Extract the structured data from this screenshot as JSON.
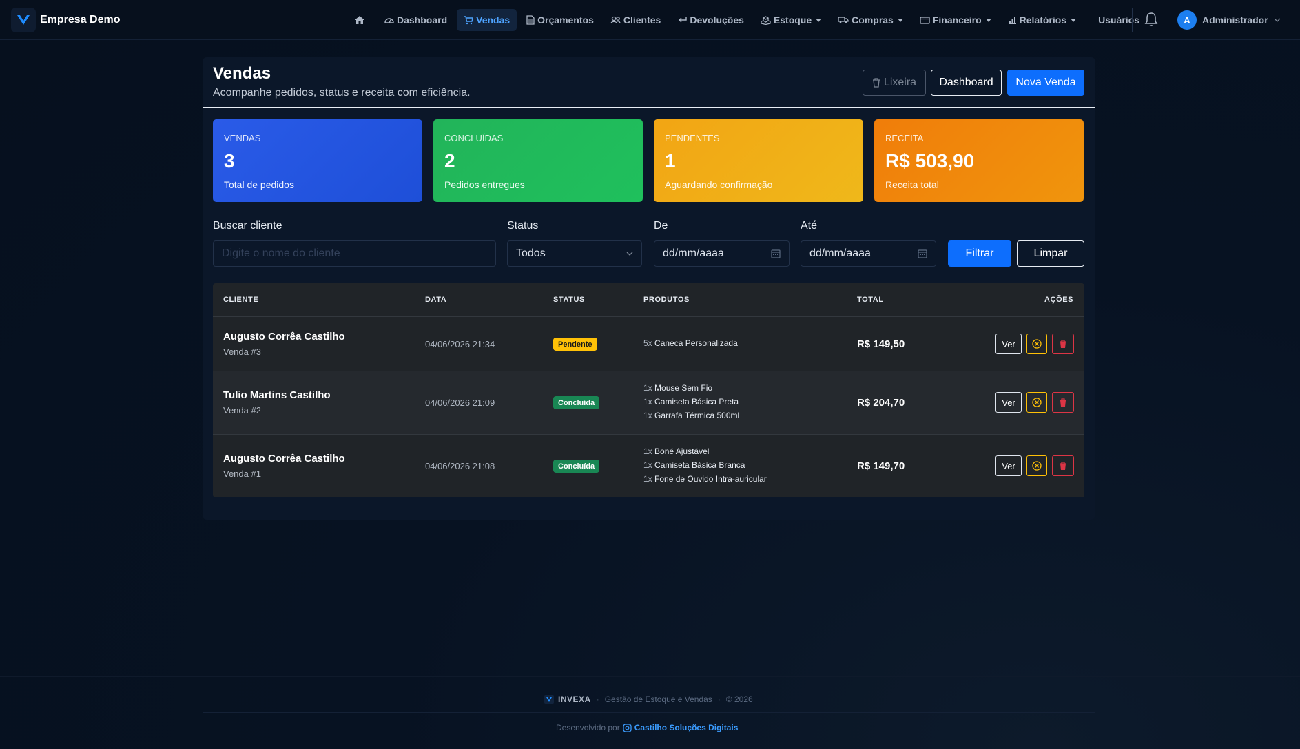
{
  "brand": {
    "name": "Empresa Demo"
  },
  "nav": {
    "items": [
      {
        "label": "",
        "icon": "home-icon"
      },
      {
        "label": "Dashboard",
        "icon": "gauge-icon"
      },
      {
        "label": "Vendas",
        "icon": "cart-icon",
        "active": true
      },
      {
        "label": "Orçamentos",
        "icon": "document-icon"
      },
      {
        "label": "Clientes",
        "icon": "people-icon"
      },
      {
        "label": "Devoluções",
        "icon": "return-icon"
      },
      {
        "label": "Estoque",
        "icon": "boxes-icon",
        "dropdown": true
      },
      {
        "label": "Compras",
        "icon": "truck-icon",
        "dropdown": true
      },
      {
        "label": "Financeiro",
        "icon": "wallet-icon",
        "dropdown": true
      },
      {
        "label": "Relatórios",
        "icon": "bar-chart-icon",
        "dropdown": true
      },
      {
        "label": "Usuários",
        "icon": ""
      }
    ],
    "user": {
      "initial": "A",
      "name": "Administrador"
    }
  },
  "header": {
    "title": "Vendas",
    "subtitle": "Acompanhe pedidos, status e receita com eficiência.",
    "trash_label": "Lixeira",
    "dashboard_label": "Dashboard",
    "new_label": "Nova Venda"
  },
  "stats": [
    {
      "label": "VENDAS",
      "value": "3",
      "desc": "Total de pedidos"
    },
    {
      "label": "CONCLUÍDAS",
      "value": "2",
      "desc": "Pedidos entregues"
    },
    {
      "label": "PENDENTES",
      "value": "1",
      "desc": "Aguardando confirmação"
    },
    {
      "label": "RECEITA",
      "value": "R$ 503,90",
      "desc": "Receita total"
    }
  ],
  "filters": {
    "client_label": "Buscar cliente",
    "client_placeholder": "Digite o nome do cliente",
    "status_label": "Status",
    "status_value": "Todos",
    "from_label": "De",
    "from_value": "dd/mm/aaaa",
    "to_label": "Até",
    "to_value": "dd/mm/aaaa",
    "filter_label": "Filtrar",
    "clear_label": "Limpar"
  },
  "table": {
    "headers": [
      "CLIENTE",
      "DATA",
      "STATUS",
      "PRODUTOS",
      "TOTAL",
      "AÇÕES"
    ],
    "view_label": "Ver",
    "rows": [
      {
        "client": "Augusto Corrêa Castilho",
        "sale": "Venda #3",
        "date": "04/06/2026 21:34",
        "status": "Pendente",
        "products": [
          {
            "qty": "5x",
            "name": "Caneca Personalizada"
          }
        ],
        "total": "R$ 149,50"
      },
      {
        "client": "Tulio Martins Castilho",
        "sale": "Venda #2",
        "date": "04/06/2026 21:09",
        "status": "Concluída",
        "products": [
          {
            "qty": "1x",
            "name": "Mouse Sem Fio"
          },
          {
            "qty": "1x",
            "name": "Camiseta Básica Preta"
          },
          {
            "qty": "1x",
            "name": "Garrafa Térmica 500ml"
          }
        ],
        "total": "R$ 204,70"
      },
      {
        "client": "Augusto Corrêa Castilho",
        "sale": "Venda #1",
        "date": "04/06/2026 21:08",
        "status": "Concluída",
        "products": [
          {
            "qty": "1x",
            "name": "Boné Ajustável"
          },
          {
            "qty": "1x",
            "name": "Camiseta Básica Branca"
          },
          {
            "qty": "1x",
            "name": "Fone de Ouvido Intra-auricular"
          }
        ],
        "total": "R$ 149,70"
      }
    ]
  },
  "footer": {
    "brand": "INVEXA",
    "tagline": "Gestão de Estoque e Vendas",
    "year": "© 2026",
    "developed_by": "Desenvolvido por",
    "credit": "Castilho Soluções Digitais"
  },
  "colors": {
    "primary": "#0d6efd",
    "stat_blue": "#2a5be8",
    "stat_green": "#22b45a",
    "stat_yellow": "#f2a514",
    "stat_orange": "#f07d0a",
    "pending": "#ffc107",
    "done": "#198754",
    "danger": "#dc3545"
  }
}
